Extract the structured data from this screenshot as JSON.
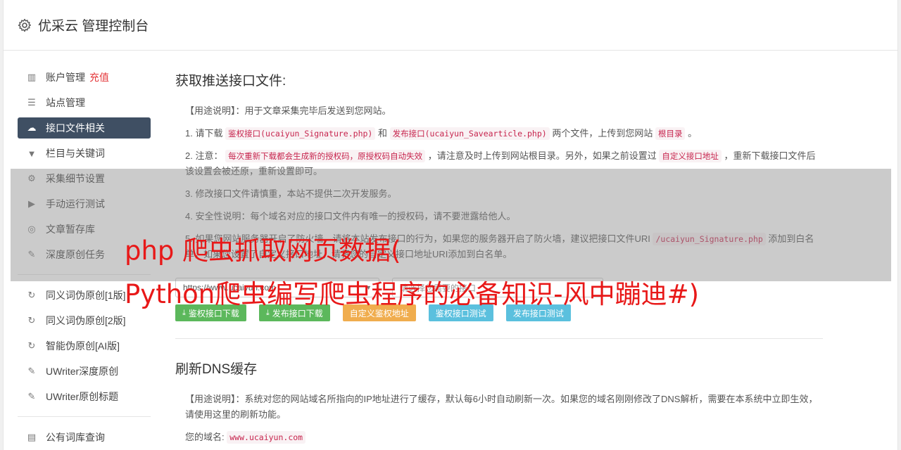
{
  "header": {
    "brand": "优采云 管理控制台"
  },
  "sidebar": {
    "group1": [
      {
        "label": "账户管理",
        "badge": "充值",
        "icon": "bar-chart-icon"
      },
      {
        "label": "站点管理",
        "icon": "server-icon"
      },
      {
        "label": "接口文件相关",
        "icon": "cloud-upload-icon",
        "active": true
      },
      {
        "label": "栏目与关键词",
        "icon": "filter-icon"
      },
      {
        "label": "采集细节设置",
        "icon": "gears-icon"
      },
      {
        "label": "手动运行测试",
        "icon": "play-circle-icon"
      },
      {
        "label": "文章暂存库",
        "icon": "database-icon"
      },
      {
        "label": "深度原创任务",
        "icon": "edit-icon"
      }
    ],
    "group2": [
      {
        "label": "同义词伪原创[1版]",
        "icon": "refresh-icon"
      },
      {
        "label": "同义词伪原创[2版]",
        "icon": "refresh-icon"
      },
      {
        "label": "智能伪原创[AI版]",
        "icon": "refresh-icon"
      },
      {
        "label": "UWriter深度原创",
        "icon": "edit-icon"
      },
      {
        "label": "UWriter原创标题",
        "icon": "edit-icon"
      }
    ],
    "group3": [
      {
        "label": "公有词库查询",
        "icon": "book-icon"
      }
    ]
  },
  "section1": {
    "title": "获取推送接口文件:",
    "usage": "【用途说明】：用于文章采集完毕后发送到您网站。",
    "p1_a": "1. 请下载",
    "p1_code1": "鉴权接口(ucaiyun_Signature.php)",
    "p1_b": "和",
    "p1_code2": "发布接口(ucaiyun_Savearticle.php)",
    "p1_c": "两个文件，上传到您网站",
    "p1_code3": "根目录",
    "p1_d": "。",
    "p2_a": "2. 注意：",
    "p2_code1": "每次重新下载都会生成新的授权码，原授权码自动失效",
    "p2_b": "，请注意及时上传到网站根目录。另外，如果之前设置过",
    "p2_code2": "自定义接口地址",
    "p2_c": "，重新下载接口文件后该设置会被还原，重新设置即可。",
    "p3": "3. 修改接口文件请慎重，本站不提供二次开发服务。",
    "p4": "4. 安全性说明：每个域名对应的接口文件内有唯一的授权码，请不要泄露给他人。",
    "p5_a": "5. 如果您网站服务器开启了防火墙，请将本站发布接口的行为，如果您的服务器开启了防火墙，建议把接口文件URI",
    "p5_code": "/ucaiyun_Signature.php",
    "p5_b": "添加到白名单，如果您设置了自定义接口地址，请将您的自定义接口地址URI添加到白名单。",
    "input1_value": "https://www.ucaiyun.com",
    "input2_placeholder": "请选择您需要的接口",
    "buttons": [
      {
        "label": "鉴权接口下载",
        "color": "#5cb85c",
        "icon": "download-icon"
      },
      {
        "label": "发布接口下载",
        "color": "#5cb85c",
        "icon": "download-icon"
      },
      {
        "label": "自定义鉴权地址",
        "color": "#f0ad4e"
      },
      {
        "label": "鉴权接口测试",
        "color": "#5bc0de"
      },
      {
        "label": "发布接口测试",
        "color": "#5bc0de"
      }
    ]
  },
  "section2": {
    "title": "刷新DNS缓存",
    "usage": "【用途说明】：系统对您的网站域名所指向的IP地址进行了缓存，默认每6小时自动刷新一次。如果您的域名刚刚修改了DNS解析，需要在本系统中立即生效，请使用这里的刷新功能。",
    "domain_label": "您的域名:",
    "domain_value": "www.ucaiyun.com"
  },
  "watermark": {
    "line1": "php 爬虫抓取网页数据(",
    "line2": "Python爬虫编写爬虫程序的必备知识-风中蹦迪#)"
  }
}
